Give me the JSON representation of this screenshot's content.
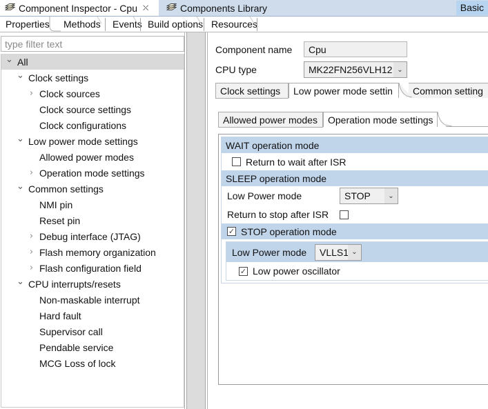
{
  "window": {
    "tabs": [
      {
        "label": "Component Inspector - Cpu",
        "icon": "component-stack-icon",
        "active": true,
        "closable": true
      },
      {
        "label": "Components Library",
        "icon": "component-stack-icon",
        "active": false,
        "closable": false
      }
    ],
    "mode_badge": "Basic"
  },
  "property_tabs": [
    {
      "label": "Properties",
      "selected": true
    },
    {
      "label": "Methods",
      "selected": false
    },
    {
      "label": "Events",
      "selected": false
    },
    {
      "label": "Build options",
      "selected": false
    },
    {
      "label": "Resources",
      "selected": false
    }
  ],
  "filter": {
    "placeholder": "type filter text",
    "value": ""
  },
  "tree": [
    {
      "label": "All",
      "indent": 0,
      "twisty": "down",
      "selected": true
    },
    {
      "label": "Clock settings",
      "indent": 1,
      "twisty": "down",
      "selected": false
    },
    {
      "label": "Clock sources",
      "indent": 2,
      "twisty": "right",
      "selected": false
    },
    {
      "label": "Clock source settings",
      "indent": 2,
      "twisty": "none",
      "selected": false
    },
    {
      "label": "Clock configurations",
      "indent": 2,
      "twisty": "none",
      "selected": false
    },
    {
      "label": "Low power mode settings",
      "indent": 1,
      "twisty": "down",
      "selected": false
    },
    {
      "label": "Allowed power modes",
      "indent": 2,
      "twisty": "none",
      "selected": false
    },
    {
      "label": "Operation mode settings",
      "indent": 2,
      "twisty": "right",
      "selected": false
    },
    {
      "label": "Common settings",
      "indent": 1,
      "twisty": "down",
      "selected": false
    },
    {
      "label": "NMI pin",
      "indent": 2,
      "twisty": "none",
      "selected": false
    },
    {
      "label": "Reset pin",
      "indent": 2,
      "twisty": "none",
      "selected": false
    },
    {
      "label": "Debug interface (JTAG)",
      "indent": 2,
      "twisty": "right",
      "selected": false
    },
    {
      "label": "Flash memory organization",
      "indent": 2,
      "twisty": "right",
      "selected": false
    },
    {
      "label": "Flash configuration field",
      "indent": 2,
      "twisty": "right",
      "selected": false
    },
    {
      "label": "CPU interrupts/resets",
      "indent": 1,
      "twisty": "down",
      "selected": false
    },
    {
      "label": "Non-maskable interrupt",
      "indent": 2,
      "twisty": "none",
      "selected": false
    },
    {
      "label": "Hard fault",
      "indent": 2,
      "twisty": "none",
      "selected": false
    },
    {
      "label": "Supervisor call",
      "indent": 2,
      "twisty": "none",
      "selected": false
    },
    {
      "label": "Pendable service",
      "indent": 2,
      "twisty": "none",
      "selected": false
    },
    {
      "label": "MCG Loss of lock",
      "indent": 2,
      "twisty": "none",
      "selected": false
    }
  ],
  "splitter": {
    "collapse_label": "<<"
  },
  "detail": {
    "component_name": {
      "label": "Component name",
      "value": "Cpu"
    },
    "cpu_type": {
      "label": "CPU type",
      "value": "MK22FN256VLH12",
      "arrow": "⌄"
    },
    "level1_tabs": [
      {
        "label": "Clock settings",
        "selected": false
      },
      {
        "label": "Low power mode settin",
        "selected": true
      },
      {
        "label": "Common setting",
        "selected": false
      }
    ],
    "level2_tabs": [
      {
        "label": "Allowed power modes",
        "selected": false
      },
      {
        "label": "Operation mode settings",
        "selected": true
      }
    ],
    "sections": [
      {
        "type": "header",
        "title": "WAIT operation mode"
      },
      {
        "type": "checkbox-row",
        "label": "Return to wait after ISR",
        "checked": false
      },
      {
        "type": "header",
        "title": "SLEEP operation mode"
      },
      {
        "type": "combo-row",
        "label": "Low Power mode",
        "value": "STOP",
        "arrow": "⌄"
      },
      {
        "type": "label-checkbox-row",
        "label": "Return to stop after ISR",
        "checked": false
      },
      {
        "type": "header-checkbox",
        "title": "STOP operation mode",
        "checked": true
      },
      {
        "type": "combo-row-blue",
        "label": "Low Power mode",
        "value": "VLLS1",
        "arrow": "⌄"
      },
      {
        "type": "checkbox-row-indent",
        "label": "Low power oscillator",
        "checked": true
      }
    ]
  },
  "colors": {
    "viewbar_bg": "#cfdcec",
    "badge_bg": "#b7d5f0",
    "section_header_blue": "#c0d4ea",
    "tree_selected": "#d9d9d9",
    "splitter_bg": "#dcdcdc",
    "field_bg": "#f0f0f0"
  }
}
